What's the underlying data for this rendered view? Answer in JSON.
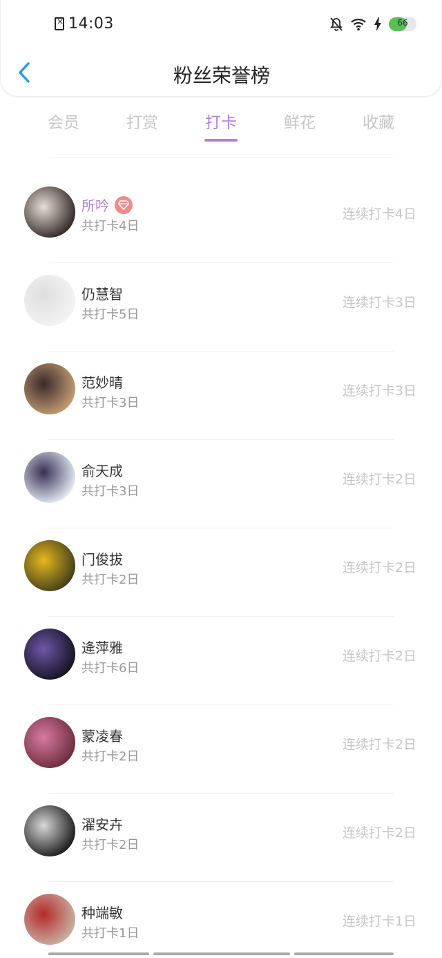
{
  "status": {
    "time": "14:03",
    "battery": "66",
    "battery_level": 0.66
  },
  "header": {
    "title": "粉丝荣誉榜"
  },
  "tabs": [
    {
      "label": "会员",
      "active": false
    },
    {
      "label": "打赏",
      "active": false
    },
    {
      "label": "打卡",
      "active": true
    },
    {
      "label": "鲜花",
      "active": false
    },
    {
      "label": "收藏",
      "active": false
    }
  ],
  "items": [
    {
      "name": "所吟",
      "vip": true,
      "total": "共打卡4日",
      "streak": "连续打卡4日",
      "colors": [
        "#2b2320",
        "#e8ddd8"
      ]
    },
    {
      "name": "仍慧智",
      "vip": false,
      "total": "共打卡5日",
      "streak": "连续打卡3日",
      "colors": [
        "#f4f4f4",
        "#dedede"
      ]
    },
    {
      "name": "范妙晴",
      "vip": false,
      "total": "共打卡3日",
      "streak": "连续打卡3日",
      "colors": [
        "#c9a077",
        "#3a2a2a"
      ]
    },
    {
      "name": "俞天成",
      "vip": false,
      "total": "共打卡3日",
      "streak": "连续打卡2日",
      "colors": [
        "#e9f2f8",
        "#3a2f55"
      ]
    },
    {
      "name": "门俊拔",
      "vip": false,
      "total": "共打卡2日",
      "streak": "连续打卡2日",
      "colors": [
        "#3c3b1a",
        "#e7b81e"
      ]
    },
    {
      "name": "逄萍雅",
      "vip": false,
      "total": "共打卡6日",
      "streak": "连续打卡2日",
      "colors": [
        "#12101c",
        "#6d58a8"
      ]
    },
    {
      "name": "蒙凌春",
      "vip": false,
      "total": "共打卡2日",
      "streak": "连续打卡2日",
      "colors": [
        "#6a2a3a",
        "#d77aa0"
      ]
    },
    {
      "name": "濯安卉",
      "vip": false,
      "total": "共打卡2日",
      "streak": "连续打卡2日",
      "colors": [
        "#151515",
        "#d8d8d8"
      ]
    },
    {
      "name": "种端敏",
      "vip": false,
      "total": "共打卡1日",
      "streak": "连续打卡1日",
      "colors": [
        "#c9b6a8",
        "#b52a2a"
      ]
    }
  ]
}
